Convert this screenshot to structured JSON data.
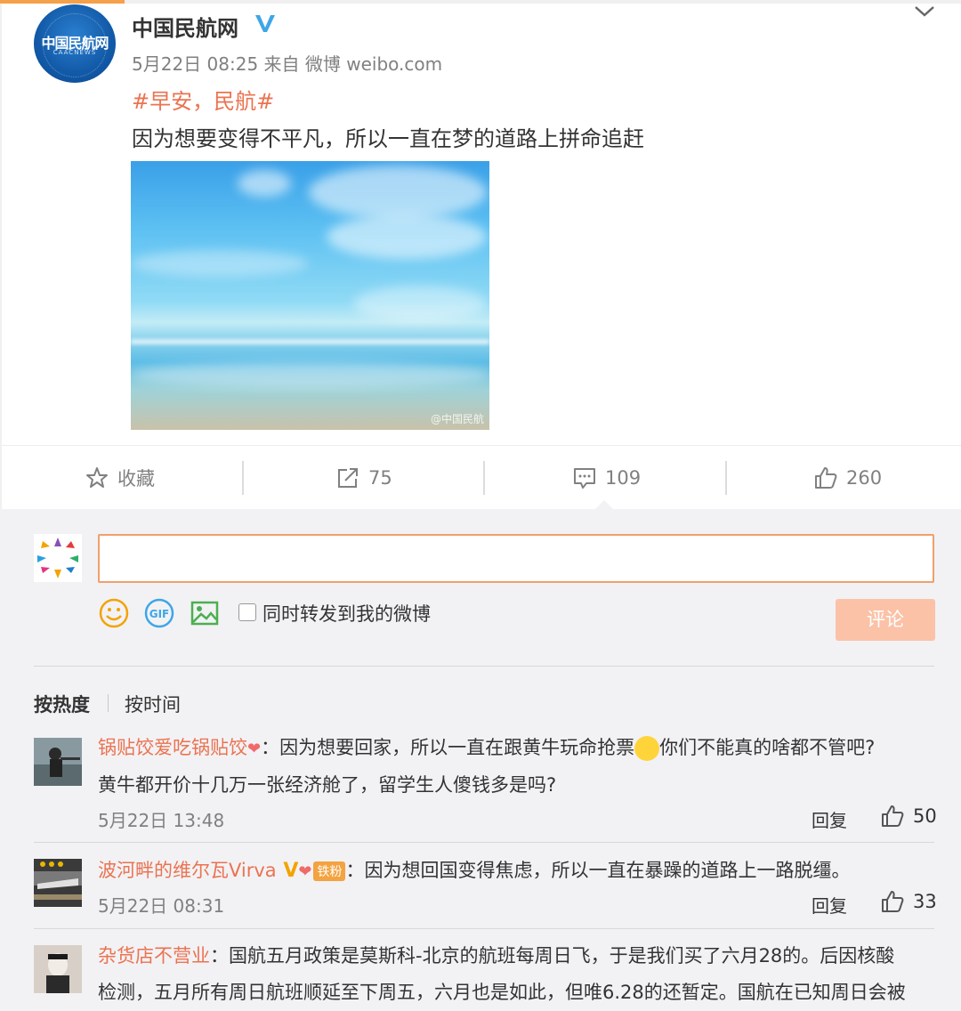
{
  "post": {
    "author": "中国民航网",
    "avatar_text": "中国民航网",
    "avatar_sub": "CAACNEWS",
    "meta": "5月22日 08:25 来自 微博 weibo.com",
    "hashtag": "#早安，民航#",
    "content": "因为想要变得不平凡，所以一直在梦的道路上拼命追赶",
    "image_watermark": "@中国民航"
  },
  "actions": {
    "favorite_label": "收藏",
    "repost_count": "75",
    "comment_count": "109",
    "like_count": "260"
  },
  "composer": {
    "input_value": "",
    "repost_checkbox_label": "同时转发到我的微博",
    "submit_label": "评论"
  },
  "sort": {
    "hot": "按热度",
    "time": "按时间"
  },
  "comments": [
    {
      "name": "锅贴饺爱吃锅贴饺",
      "text_line1": "：因为想要回家，所以一直在跟黄牛玩命抢票",
      "text_line1b": "你们不能真的啥都不管吧?",
      "text_line2": "黄牛都开价十几万一张经济舱了，留学生人傻钱多是吗?",
      "time": "5月22日 13:48",
      "reply": "回复",
      "likes": "50"
    },
    {
      "name": "波河畔的维尔瓦Virva",
      "badge": "铁粉",
      "text_line1": "：因为想回国变得焦虑，所以一直在暴躁的道路上一路脱缰。",
      "time": "5月22日 08:31",
      "reply": "回复",
      "likes": "33"
    },
    {
      "name": "杂货店不营业",
      "text_line1": "：国航五月政策是莫斯科-北京的航班每周日飞，于是我们买了六月28的。后因核酸",
      "text_line2": "检测，五月所有周日航班顺延至下周五，六月也是如此，但唯6.28的还暂定。国航在已知周日会被"
    }
  ],
  "colors": {
    "accent": "#eb7350",
    "verified": "#3ea6e8",
    "submit_disabled": "#fbc2a7"
  }
}
